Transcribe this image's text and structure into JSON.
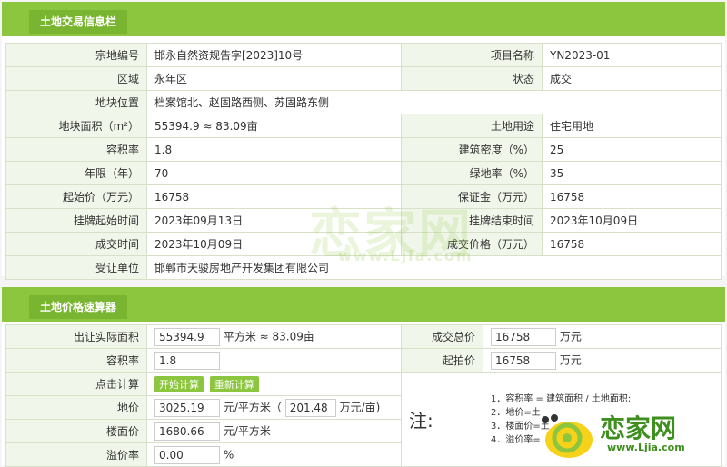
{
  "section1": {
    "title": "土地交易信息栏",
    "rows": [
      {
        "l1": "宗地编号",
        "v1": "邯永自然资规告字[2023]10号",
        "l2": "项目名称",
        "v2": "YN2023-01"
      },
      {
        "l1": "区域",
        "v1": "永年区",
        "l2": "状态",
        "v2": "成交"
      },
      {
        "l1": "地块位置",
        "v1": "档案馆北、赵固路西侧、苏固路东侧"
      },
      {
        "l1": "地块面积（m²）",
        "v1": "55394.9 ≈ 83.09亩",
        "l2": "土地用途",
        "v2": "住宅用地"
      },
      {
        "l1": "容积率",
        "v1": "1.8",
        "l2": "建筑密度（%）",
        "v2": "25"
      },
      {
        "l1": "年限（年）",
        "v1": "70",
        "l2": "绿地率（%）",
        "v2": "35"
      },
      {
        "l1": "起始价（万元）",
        "v1": "16758",
        "l2": "保证金（万元）",
        "v2": "16758"
      },
      {
        "l1": "挂牌起始时间",
        "v1": "2023年09月13日",
        "l2": "挂牌结束时间",
        "v2": "2023年10月09日"
      },
      {
        "l1": "成交时间",
        "v1": "2023年10月09日",
        "l2": "成交价格（万元）",
        "v2": "16758"
      },
      {
        "l1": "受让单位",
        "v1": "邯郸市天骏房地产开发集团有限公司"
      }
    ]
  },
  "section2": {
    "title": "土地价格速算器",
    "area_label": "出让实际面积",
    "area_value": "55394.9",
    "area_unit": "平方米 ≈",
    "area_mu": "83.09亩",
    "total_label": "成交总价",
    "total_value": "16758",
    "total_unit": "万元",
    "far_label": "容积率",
    "far_value": "1.8",
    "start_label": "起拍价",
    "start_value": "16758",
    "start_unit": "万元",
    "click_label": "点击计算",
    "btn_start": "开始计算",
    "btn_reset": "重新计算",
    "land_price_label": "地价",
    "land_price_value": "3025.19",
    "land_price_unit": "元/平方米（",
    "land_price_mu_value": "201.48",
    "land_price_mu_unit": "万元/亩)",
    "floor_price_label": "楼面价",
    "floor_price_value": "1680.66",
    "floor_price_unit": "元/平方米",
    "premium_label": "溢价率",
    "premium_value": "0.00",
    "premium_unit": "%",
    "note_label": "注:",
    "notes": [
      "1．容积率 = 建筑面积 / 土地面积;",
      "2．地价=土",
      "3．楼面价=土",
      "4．溢价率=（成"
    ]
  },
  "watermark": {
    "text": "恋家网",
    "sub": "www.Ljia.com"
  },
  "logo": {
    "text": "恋家网",
    "sub": "www.Ljia.com"
  },
  "colors": {
    "accent": "#8cc63f",
    "header_tab": "#7ab531",
    "label_bg": "#f1f6ea"
  }
}
